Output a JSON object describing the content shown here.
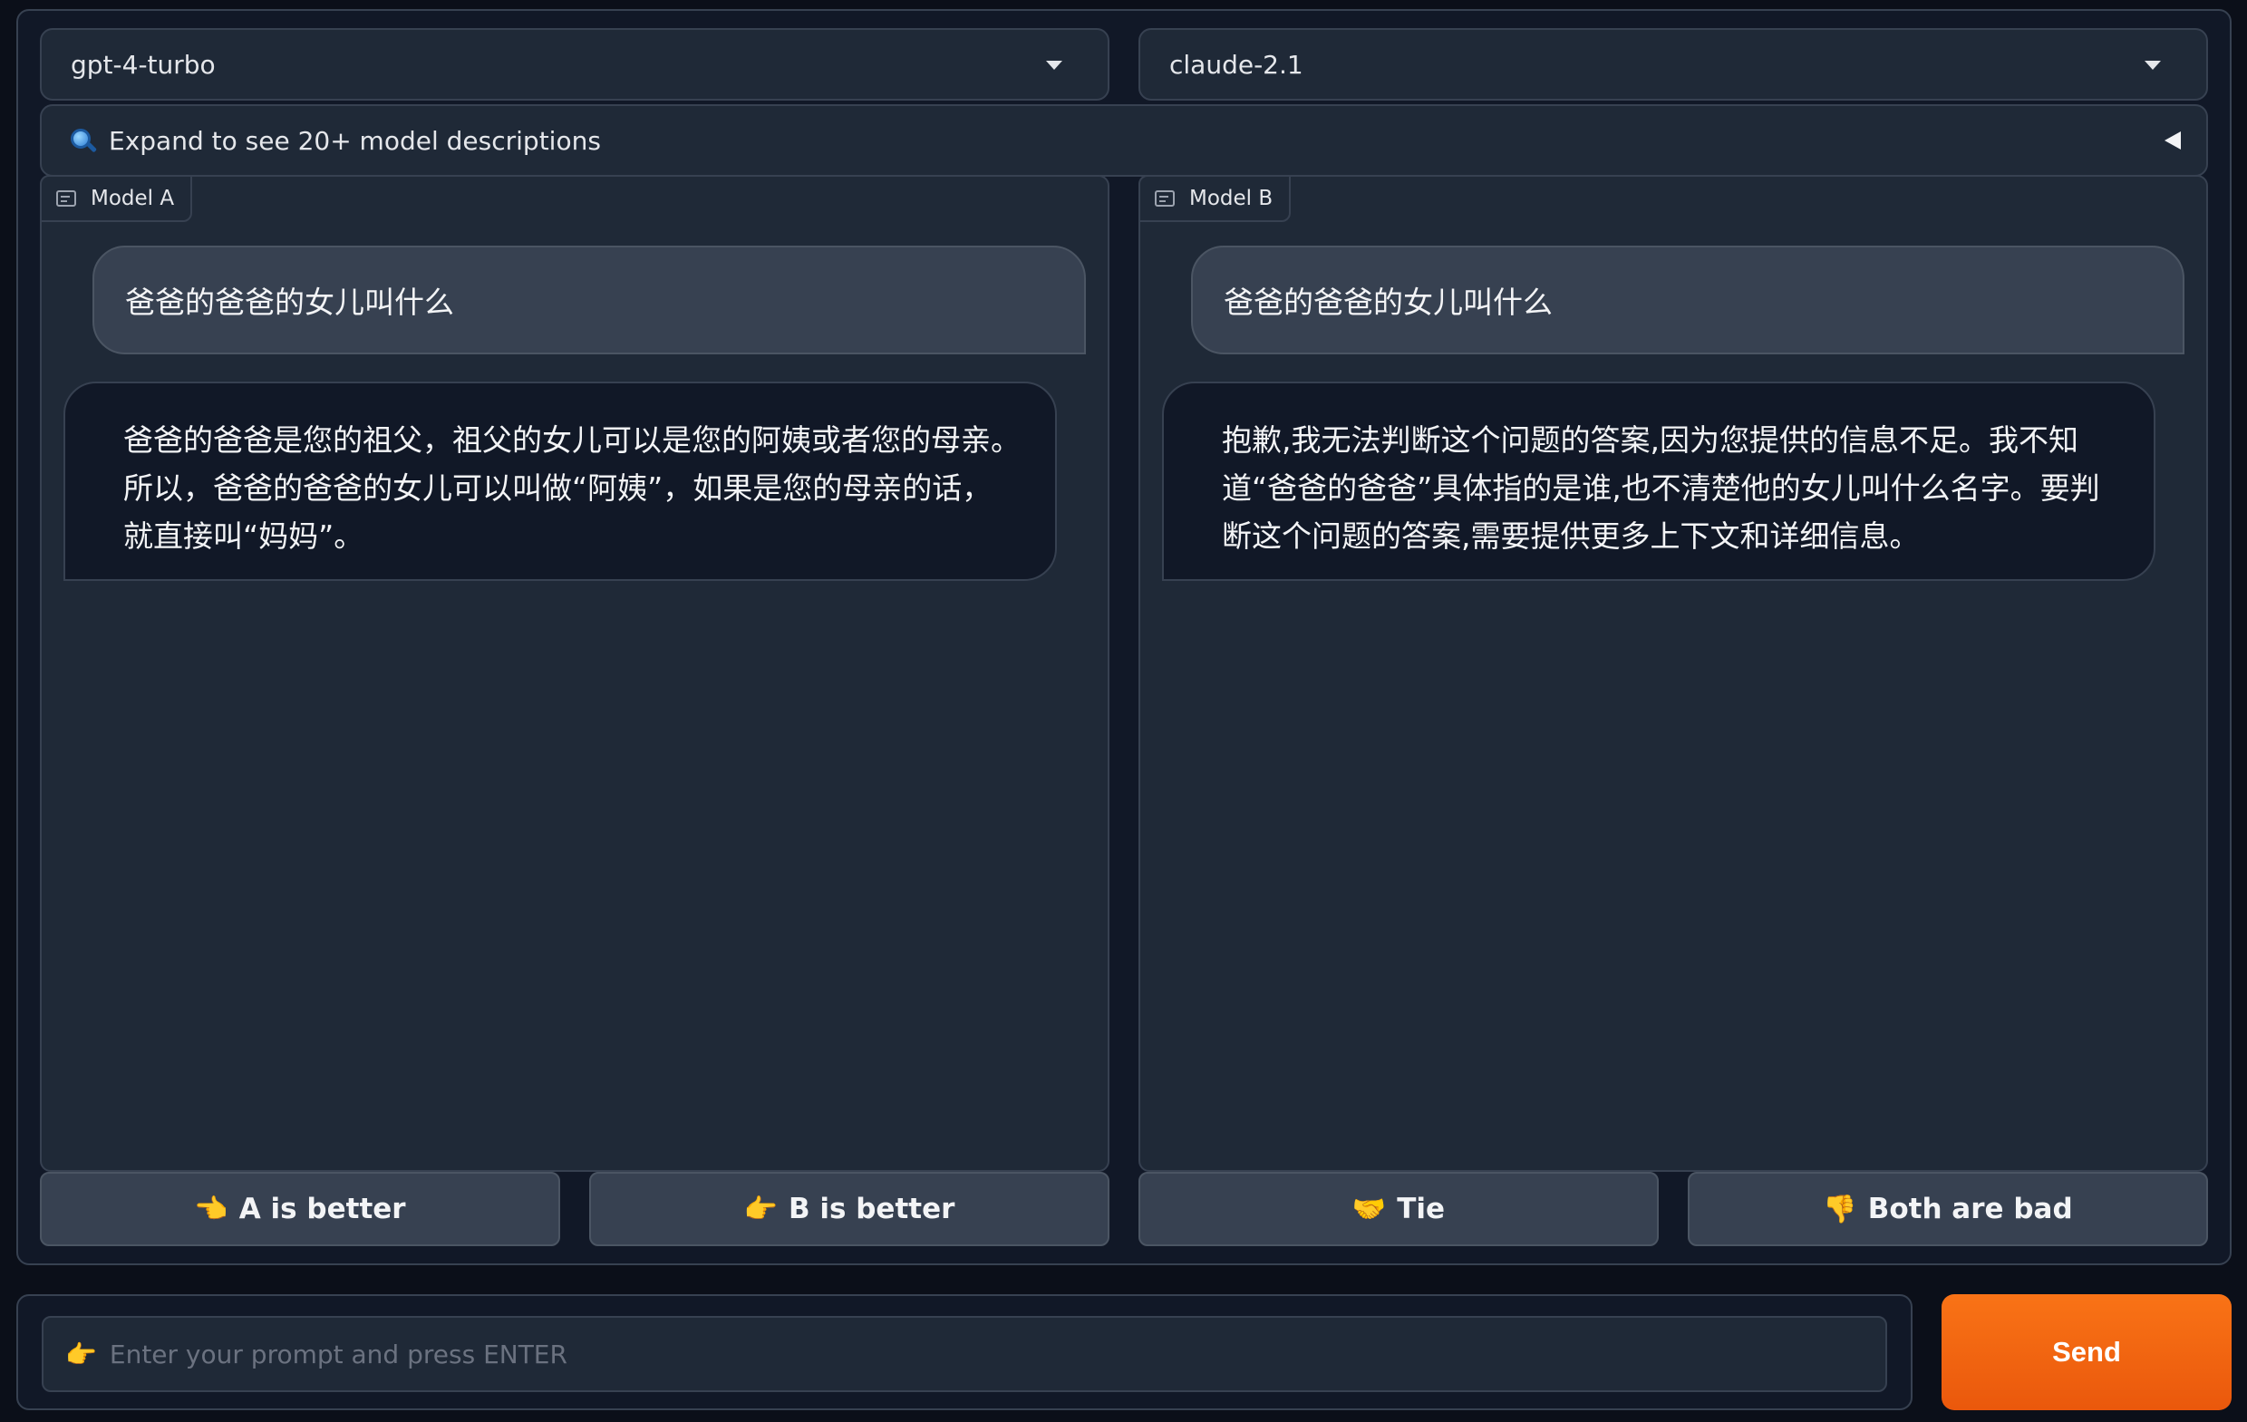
{
  "models": {
    "model_a": "gpt-4-turbo",
    "model_b": "claude-2.1"
  },
  "accordion": {
    "icon": "magnifier-icon",
    "label": "Expand to see 20+ model descriptions"
  },
  "chat_a": {
    "label": "Model A",
    "user_message": "爸爸的爸爸的女儿叫什么",
    "bot_message": "爸爸的爸爸是您的祖父，祖父的女儿可以是您的阿姨或者您的母亲。所以，爸爸的爸爸的女儿可以叫做“阿姨”，如果是您的母亲的话，就直接叫“妈妈”。"
  },
  "chat_b": {
    "label": "Model B",
    "user_message": "爸爸的爸爸的女儿叫什么",
    "bot_message": "抱歉,我无法判断这个问题的答案,因为您提供的信息不足。我不知道“爸爸的爸爸”具体指的是谁,也不清楚他的女儿叫什么名字。要判断这个问题的答案,需要提供更多上下文和详细信息。"
  },
  "votes": {
    "a_better": {
      "emoji": "👈",
      "label": "A is better"
    },
    "b_better": {
      "emoji": "👉",
      "label": "B is better"
    },
    "tie": {
      "emoji": "🤝",
      "label": "Tie"
    },
    "both_bad": {
      "emoji": "👎",
      "label": "Both are bad"
    }
  },
  "prompt": {
    "emoji": "👉",
    "placeholder": "Enter your prompt and press ENTER",
    "value": ""
  },
  "send": {
    "label": "Send"
  },
  "colors": {
    "background": "#0b0f19",
    "panel": "#1f2937",
    "border": "#374151",
    "accent": "#f97316"
  }
}
